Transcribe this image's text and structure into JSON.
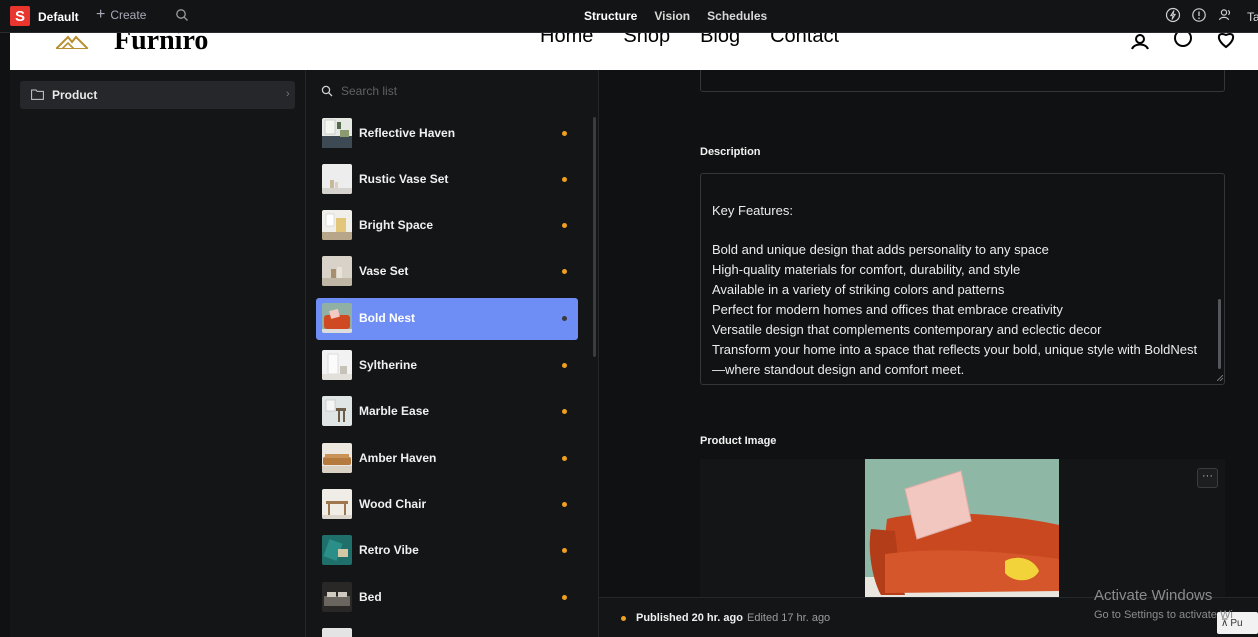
{
  "topbar": {
    "logo_letter": "S",
    "workspace": "Default",
    "create_label": "Create",
    "tabs": [
      {
        "label": "Structure",
        "active": true
      },
      {
        "label": "Vision",
        "active": false
      },
      {
        "label": "Schedules",
        "active": false
      }
    ],
    "icons": [
      "bolt-icon",
      "help-icon",
      "users-icon"
    ],
    "tail_text": "Ta"
  },
  "site_preview": {
    "logo_text": "Furniro",
    "nav": [
      "Home",
      "Shop",
      "Blog",
      "Contact"
    ],
    "icons": [
      "account-icon",
      "search-icon",
      "heart-icon"
    ]
  },
  "structure": {
    "folder_label": "Product"
  },
  "list": {
    "search_placeholder": "Search list",
    "items": [
      {
        "label": "Reflective Haven",
        "selected": false
      },
      {
        "label": "Rustic Vase Set",
        "selected": false
      },
      {
        "label": "Bright Space",
        "selected": false
      },
      {
        "label": "Vase Set",
        "selected": false
      },
      {
        "label": "Bold Nest",
        "selected": true
      },
      {
        "label": "Syltherine",
        "selected": false
      },
      {
        "label": "Marble Ease",
        "selected": false
      },
      {
        "label": "Amber Haven",
        "selected": false
      },
      {
        "label": "Wood Chair",
        "selected": false
      },
      {
        "label": "Retro Vibe",
        "selected": false
      },
      {
        "label": "Bed",
        "selected": false
      }
    ]
  },
  "document": {
    "description_label": "Description",
    "description_lines": [
      "Key Features:",
      "",
      "Bold and unique design that adds personality to any space",
      "High-quality materials for comfort, durability, and style",
      "Available in a variety of striking colors and patterns",
      "Perfect for modern homes and offices that embrace creativity",
      "Versatile design that complements contemporary and eclectic decor",
      "Transform your home into a space that reflects your bold, unique style with BoldNest",
      "—where standout design and comfort meet."
    ],
    "image_label": "Product Image",
    "more_label": "···"
  },
  "status": {
    "published": "Published 20 hr. ago",
    "edited": "Edited 17 hr. ago",
    "publish_partial": "Pu"
  },
  "watermark": {
    "line1": "Activate Windows",
    "line2": "Go to Settings to activate Wi"
  },
  "colors": {
    "accent": "#6f8ef5",
    "dot": "#f0a020",
    "brand_red": "#e8352e"
  }
}
